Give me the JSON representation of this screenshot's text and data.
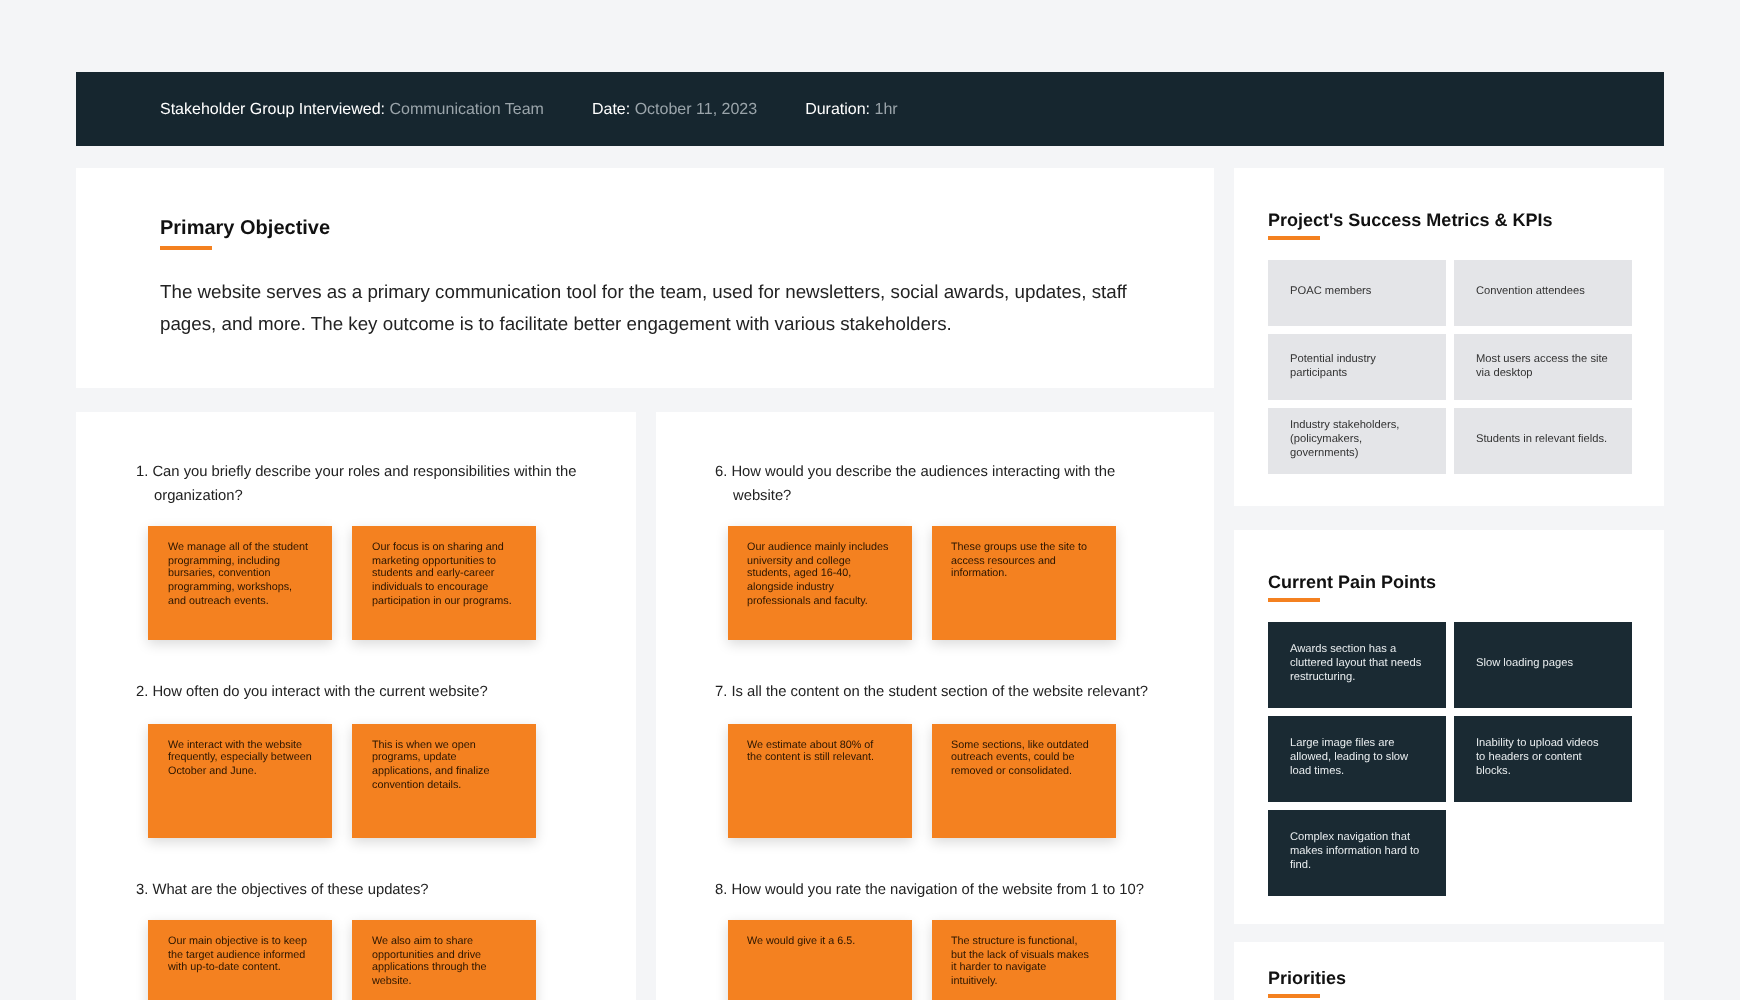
{
  "header": [
    {
      "label": "Stakeholder Group Interviewed:",
      "value": "Communication Team"
    },
    {
      "label": "Date:",
      "value": "October 11, 2023"
    },
    {
      "label": "Duration:",
      "value": "1hr"
    }
  ],
  "objective": {
    "title": "Primary Objective",
    "text": "The website serves as a primary communication tool for the team, used for newsletters, social awards, updates, staff pages, and more. The key outcome is to facilitate better engagement with various stakeholders."
  },
  "question_columns": [
    {
      "questions": [
        {
          "question": "1. Can you briefly describe your roles and responsibilities within the organization?",
          "answers": [
            "We manage all of the student programming, including bursaries, convention programming, workshops, and outreach events.",
            "Our focus is on sharing and marketing opportunities to students and early-career individuals to encourage participation in our programs."
          ]
        },
        {
          "question": "2. How often do you interact with the current website?",
          "answers": [
            "We interact with the website frequently, especially between October and June.",
            "This is when we open programs, update applications, and finalize convention details."
          ]
        },
        {
          "question": "3. What are the objectives of these updates?",
          "answers": [
            "Our main objective is to keep the target audience informed with up-to-date content.",
            "We also aim to share opportunities and drive applications through the website."
          ]
        }
      ]
    },
    {
      "questions": [
        {
          "question": "6. How would you describe the audiences interacting with the website?",
          "answers": [
            "Our audience mainly includes university and college students, aged 16-40, alongside industry professionals and faculty.",
            "These groups use the site to access resources and information."
          ]
        },
        {
          "question": "7. Is all the content on the student section of the website relevant?",
          "answers": [
            "We estimate about 80% of the content is still relevant.",
            "Some sections, like outdated outreach events, could be removed or consolidated."
          ]
        },
        {
          "question": "8. How would you rate the navigation of the website from 1 to 10?",
          "answers": [
            "We would give it a 6.5.",
            "The structure is functional, but the lack of visuals makes it harder to navigate intuitively."
          ]
        }
      ]
    }
  ],
  "metrics": {
    "title": "Project's Success Metrics & KPIs",
    "items": [
      "POAC members",
      "Convention attendees",
      "Potential industry participants",
      "Most users access the site via desktop",
      "Industry stakeholders, (policymakers, governments)",
      "Students in relevant fields."
    ]
  },
  "pain_points": {
    "title": "Current Pain Points",
    "items": [
      "Awards section has a cluttered layout that needs restructuring.",
      "Slow loading pages",
      "Large image files are allowed, leading to slow load times.",
      "Inability to upload videos to headers or content blocks.",
      "Complex navigation that makes information hard to find."
    ]
  },
  "priorities": {
    "title": "Priorities"
  }
}
